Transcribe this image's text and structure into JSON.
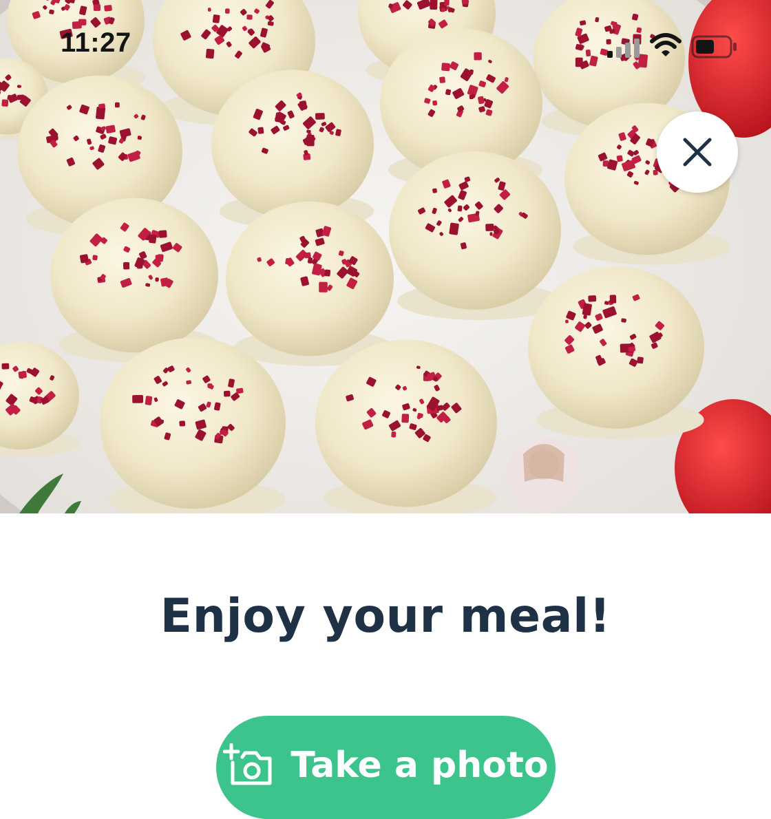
{
  "status_bar": {
    "time": "11:27",
    "icons": [
      "signal-icon",
      "wifi-icon",
      "battery-icon"
    ]
  },
  "hero": {
    "image": "food-photo",
    "close_icon": "close-icon"
  },
  "main": {
    "title": "Enjoy your meal!",
    "photo_button": {
      "label": "Take a photo",
      "icon": "add-photo-icon"
    }
  },
  "colors": {
    "accent": "#3dc48d",
    "title": "#1e3145",
    "icon_dark": "#1e3145"
  }
}
